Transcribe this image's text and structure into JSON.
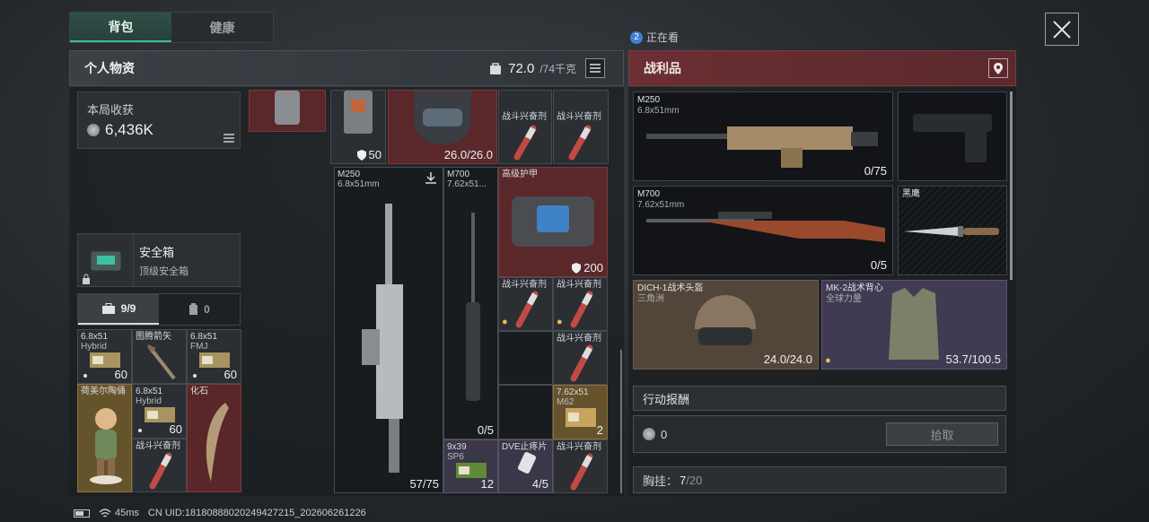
{
  "tabs": [
    {
      "label": "背包",
      "active": true
    },
    {
      "label": "健康",
      "active": false
    }
  ],
  "watching": {
    "count": "2",
    "label": "正在看"
  },
  "left_panel": {
    "title": "个人物资",
    "weight_current": "72.0",
    "weight_max": "/74千克",
    "harvest_label": "本局收获",
    "harvest_value": "6,436K",
    "safebox_name": "安全箱",
    "safebox_type": "顶级安全箱",
    "subtabs": [
      {
        "label": "9/9",
        "icon": "briefcase-icon",
        "active": true
      },
      {
        "label": "0",
        "icon": "canister-icon",
        "active": false
      }
    ],
    "pocket_items": [
      {
        "name": "6.8x51",
        "sub": "Hybrid",
        "count": "60"
      },
      {
        "name": "图腾箭矢",
        "sub": "",
        "count": ""
      },
      {
        "name": "6.8x51",
        "sub": "FMJ",
        "count": "60"
      },
      {
        "name": "荷美尔陶俑",
        "sub": "",
        "count": ""
      },
      {
        "name": "6.8x51",
        "sub": "Hybrid",
        "count": "60"
      },
      {
        "name": "化石",
        "sub": "",
        "count": ""
      },
      {
        "name": "战斗兴奋剂",
        "sub": "",
        "count": ""
      }
    ],
    "grid_items": {
      "vest_armor": "50",
      "helmet_durability": "26.0/26.0",
      "stim_a": "战斗兴奋剂",
      "stim_b": "战斗兴奋剂",
      "m250_name": "M250",
      "m250_caliber": "6.8x51mm",
      "m250_count": "57/75",
      "m700_name": "M700",
      "m700_caliber": "7.62x51...",
      "m700_count": "0/5",
      "armor_name": "高级护甲",
      "armor_value": "200",
      "stim_c": "战斗兴奋剂",
      "stim_d": "战斗兴奋剂",
      "stim_e": "战斗兴奋剂",
      "ammo_762_name": "7.62x51",
      "ammo_762_sub": "M62",
      "ammo_762_count": "2",
      "ammo_939_name": "9x39",
      "ammo_939_sub": "SP6",
      "ammo_939_count": "12",
      "dve_name": "DVE止疼片",
      "dve_count": "4/5",
      "stim_f": "战斗兴奋剂"
    }
  },
  "right_panel": {
    "title": "战利品",
    "loot": [
      {
        "name": "M250",
        "sub": "6.8x51mm",
        "count": "0/75"
      },
      {
        "name": "",
        "sub": "",
        "count": ""
      },
      {
        "name": "M700",
        "sub": "7.62x51mm",
        "count": "0/5"
      },
      {
        "name": "黑鹰",
        "sub": "",
        "count": ""
      },
      {
        "name": "DICH-1战术头盔",
        "sub": "三角洲",
        "count": "24.0/24.0"
      },
      {
        "name": "MK-2战术背心",
        "sub": "全球力量",
        "count": "53.7/100.5"
      }
    ],
    "reward_title": "行动报酬",
    "reward_value": "0",
    "pickup_label": "拾取",
    "chest_label": "胸挂：",
    "chest_current": "7",
    "chest_max": "/20"
  },
  "status_bar": {
    "ping": "45ms",
    "uid": "CN UID:18180888020249427215_202606261226"
  },
  "colors": {
    "accent": "#3fbf9a",
    "loot_header": "#6b2f34",
    "legendary": "#6e282c",
    "gold": "#786030",
    "epic": "#3e3a4e"
  }
}
